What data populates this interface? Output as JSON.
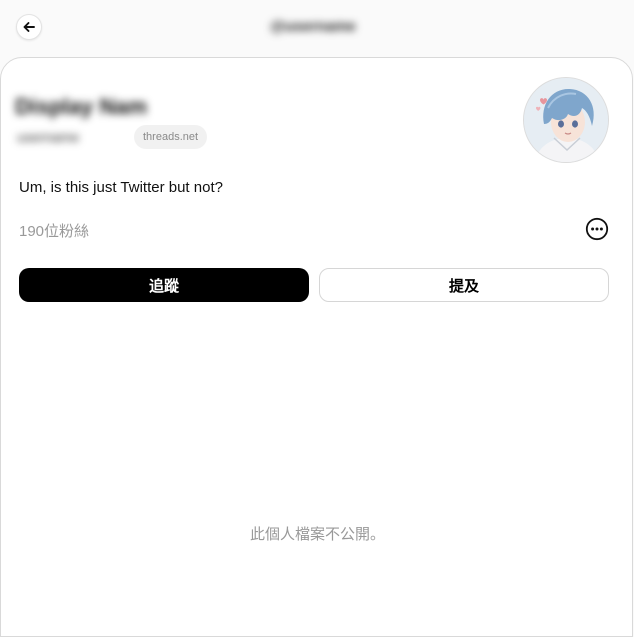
{
  "header": {
    "back_icon": "arrow-left-icon",
    "title": "@username"
  },
  "profile": {
    "display_name": "Display Name",
    "username": "username",
    "domain_chip": "threads.net",
    "bio": "Um, is this just Twitter but not?",
    "followers": "190位粉絲",
    "more_icon": "more-horizontal-circle-icon",
    "avatar": "anime-style-avatar-blue-hair"
  },
  "actions": {
    "follow_label": "追蹤",
    "mention_label": "提及"
  },
  "notice": {
    "private_text": "此個人檔案不公開。"
  },
  "colors": {
    "primary_button": "#000000",
    "secondary_text": "#999999",
    "avatar_hair": "#7fa6cc",
    "heart": "#e8959c"
  }
}
